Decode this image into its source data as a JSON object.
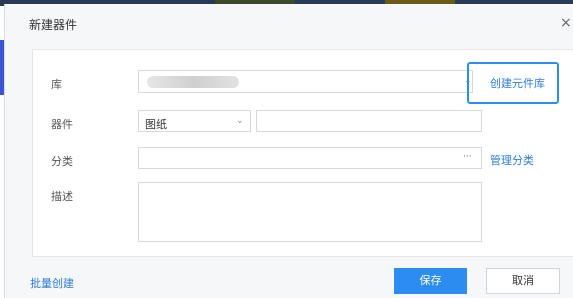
{
  "dialog": {
    "title": "新建器件",
    "close_label": "×"
  },
  "form": {
    "library": {
      "label": "库",
      "value": "",
      "create_link": "创建元件库"
    },
    "component": {
      "label": "器件",
      "type_value": "图纸",
      "name_value": ""
    },
    "category": {
      "label": "分类",
      "value": "",
      "ellipsis": "···",
      "manage_link": "管理分类"
    },
    "description": {
      "label": "描述",
      "value": ""
    }
  },
  "footer": {
    "batch_create": "批量创建",
    "save": "保存",
    "cancel": "取消"
  },
  "colors": {
    "accent": "#2d8cf0",
    "link": "#2f7bd8"
  }
}
